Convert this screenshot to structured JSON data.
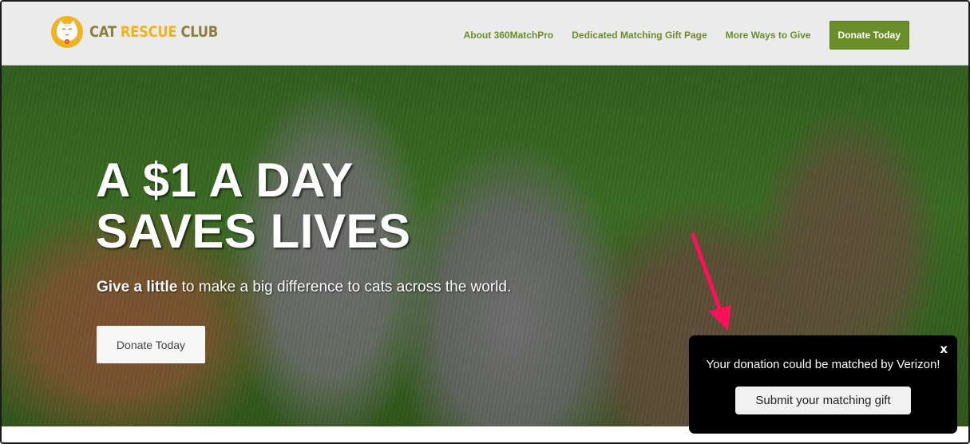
{
  "header": {
    "logo": {
      "icon": "cat-face-icon",
      "word1": "CAT",
      "word2": "RESCUE",
      "word3": "CLUB",
      "brand_color": "#f2b21b",
      "text_color": "#8d7d3e"
    },
    "nav": [
      {
        "label": "About 360MatchPro"
      },
      {
        "label": "Dedicated Matching Gift Page"
      },
      {
        "label": "More Ways to Give"
      }
    ],
    "donate_label": "Donate Today",
    "accent_color": "#6a8e2a"
  },
  "hero": {
    "headline_line1": "A $1 A DAY",
    "headline_line2": "SAVES LIVES",
    "sub_bold": "Give a little",
    "sub_rest": " to make a big difference to cats across the world.",
    "button_label": "Donate Today",
    "background": "kittens-on-grass-photo"
  },
  "annotation": {
    "icon": "arrow-pointer-icon",
    "color": "#ff1158"
  },
  "popup": {
    "message": "Your donation could be matched by Verizon!",
    "button_label": "Submit your matching gift",
    "close_label": "x"
  }
}
